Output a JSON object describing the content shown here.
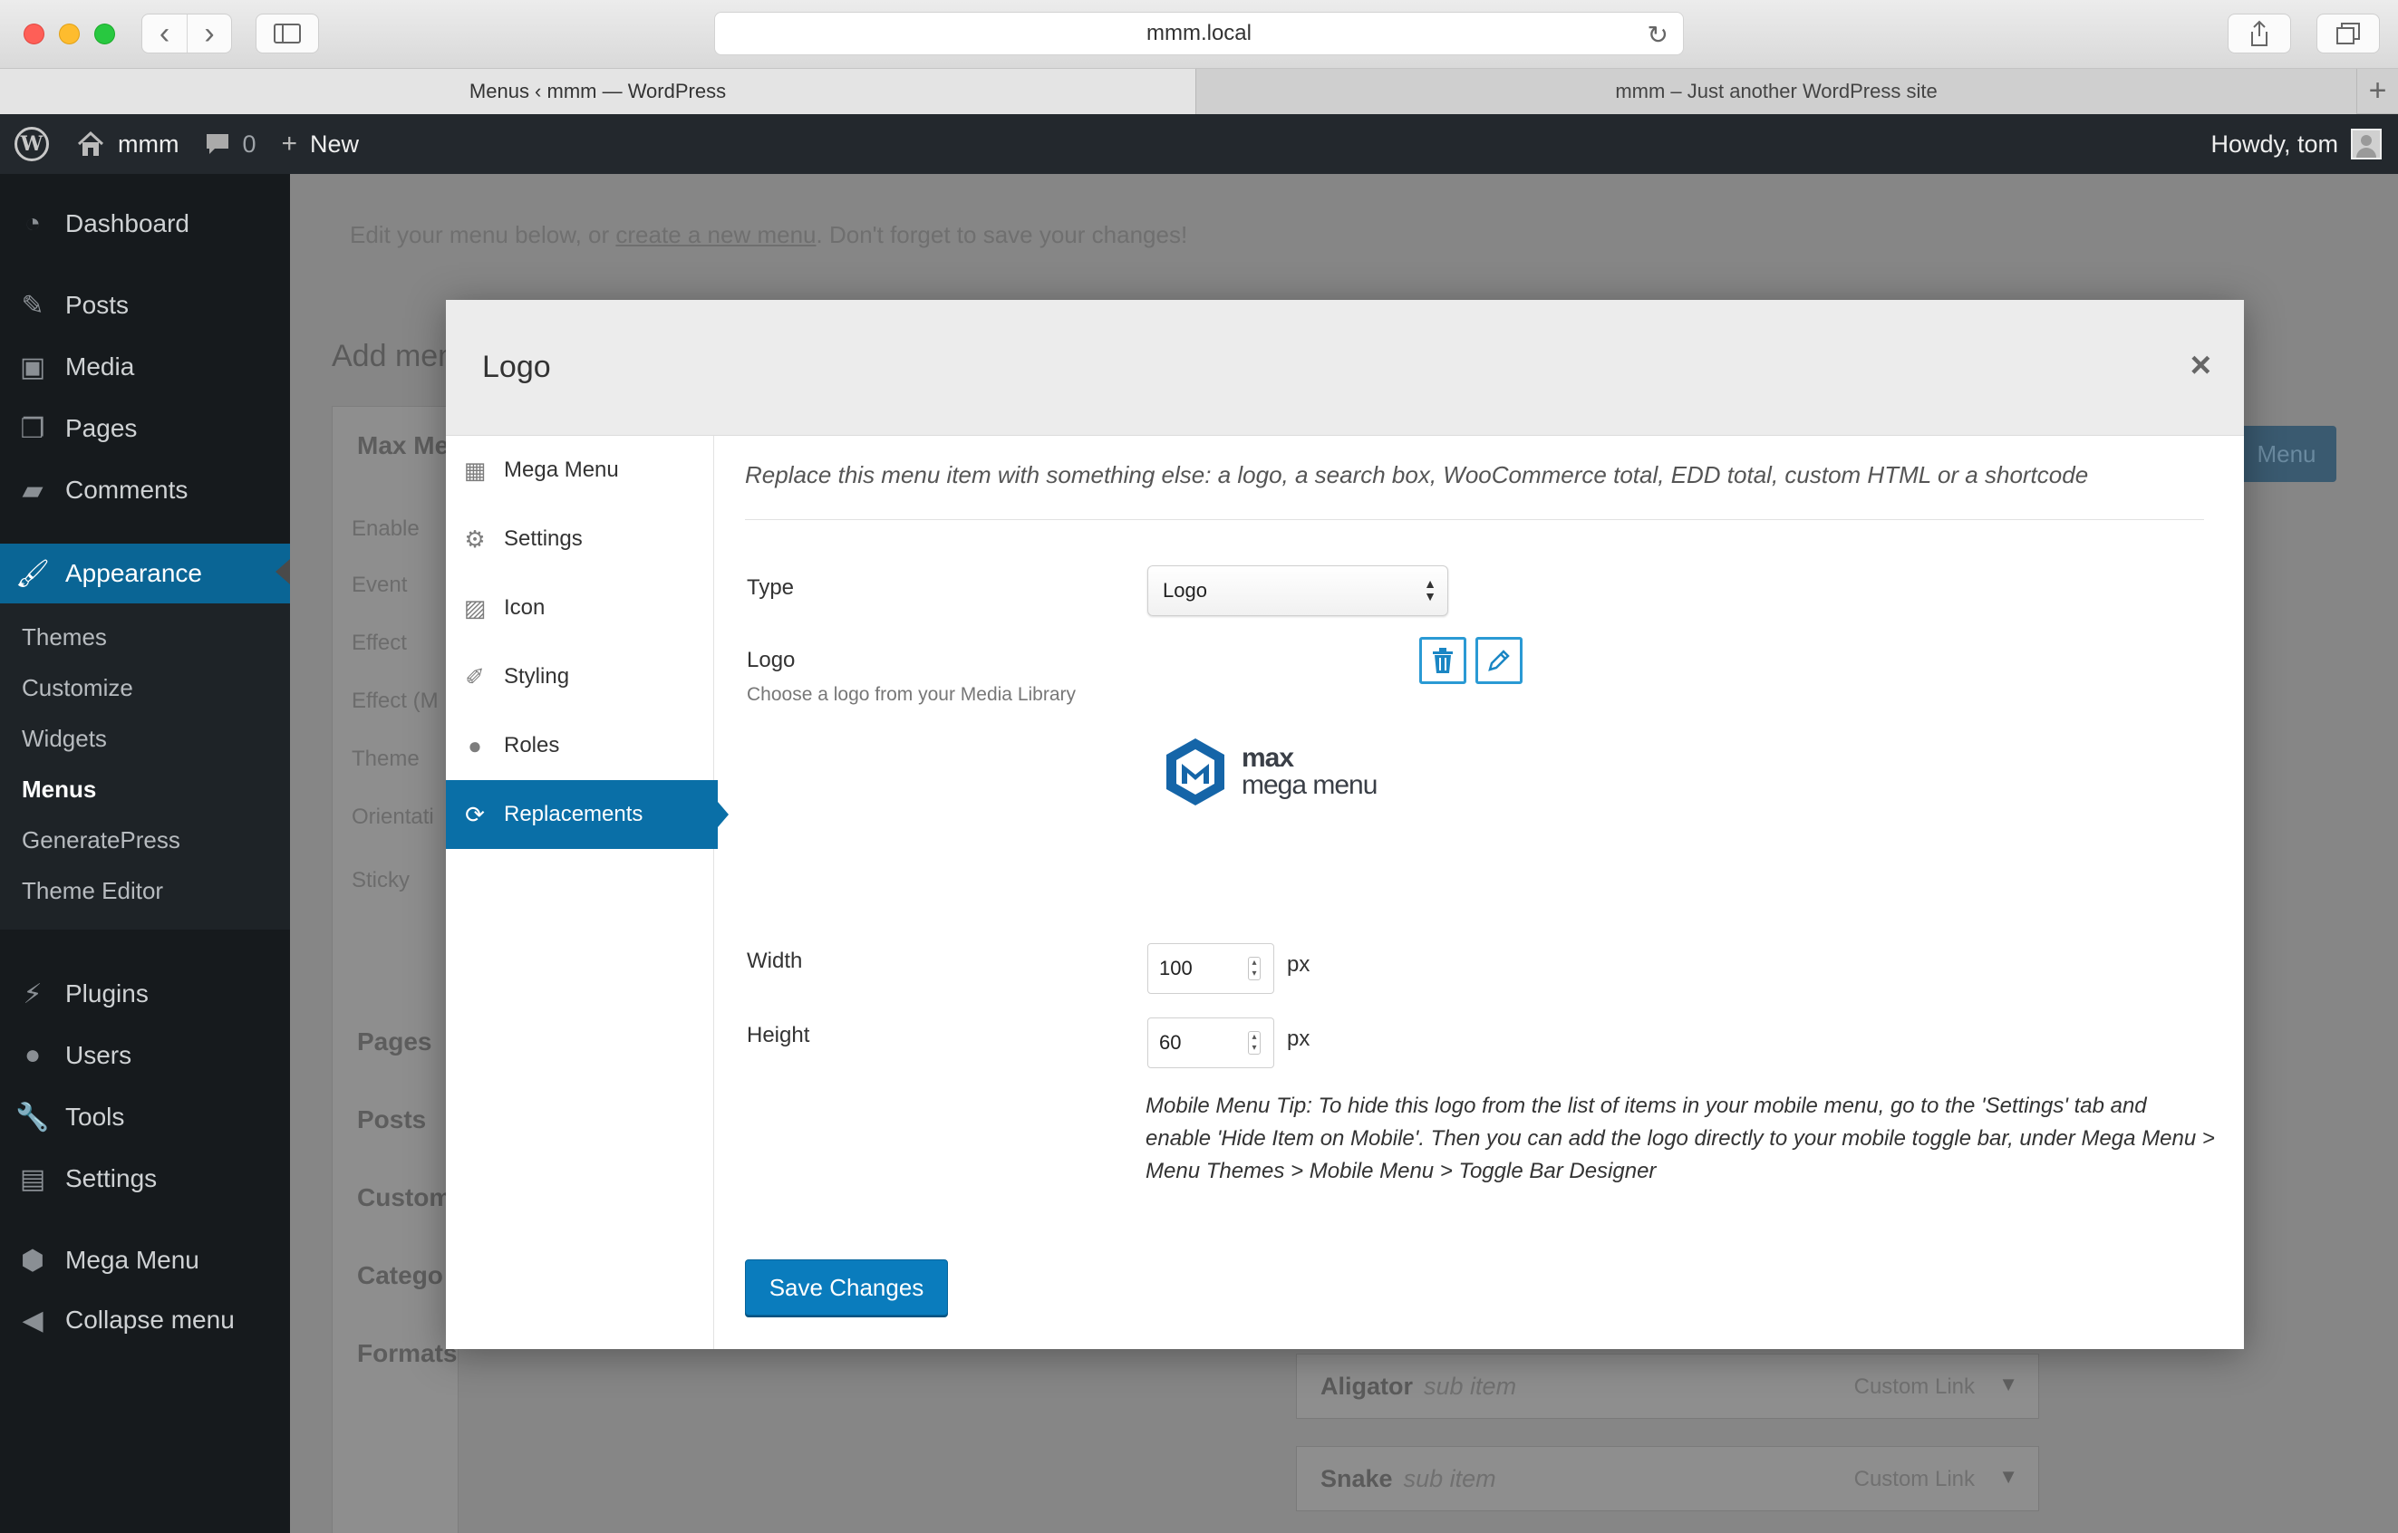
{
  "browser": {
    "url": "mmm.local",
    "tabs": [
      "Menus ‹ mmm — WordPress",
      "mmm – Just another WordPress site"
    ],
    "new_tab_symbol": "+"
  },
  "adminbar": {
    "site_name": "mmm",
    "comments_count": "0",
    "new_label": "New",
    "greeting": "Howdy, tom"
  },
  "sidebar": {
    "items": [
      {
        "label": "Dashboard",
        "icon": "dashboard-icon"
      },
      {
        "label": "Posts",
        "icon": "pin-icon"
      },
      {
        "label": "Media",
        "icon": "media-icon"
      },
      {
        "label": "Pages",
        "icon": "pages-icon"
      },
      {
        "label": "Comments",
        "icon": "comment-icon"
      },
      {
        "label": "Appearance",
        "icon": "paintbrush-icon"
      },
      {
        "label": "Plugins",
        "icon": "plug-icon"
      },
      {
        "label": "Users",
        "icon": "users-icon"
      },
      {
        "label": "Tools",
        "icon": "wrench-icon"
      },
      {
        "label": "Settings",
        "icon": "settings-icon"
      },
      {
        "label": "Mega Menu",
        "icon": "megamenu-icon"
      },
      {
        "label": "Collapse menu",
        "icon": "collapse-icon"
      }
    ],
    "submenu": [
      "Themes",
      "Customize",
      "Widgets",
      "Menus",
      "GeneratePress",
      "Theme Editor"
    ]
  },
  "background": {
    "intro_before": "Edit your menu below, or ",
    "intro_link": "create a new menu",
    "intro_after": ". Don't forget to save your changes!",
    "heading": "Add men",
    "panel_title": "Max Me",
    "panel_labels": [
      "Enable",
      "Event",
      "Effect",
      "Effect (M",
      "Theme",
      "Orientati",
      "Sticky"
    ],
    "sections": [
      "Pages",
      "Posts",
      "Custom",
      "Catego",
      "Formats"
    ],
    "button_fragment": "Menu",
    "menu_rows": [
      {
        "title": "Aligator",
        "sub": "sub item",
        "type": "Custom Link"
      },
      {
        "title": "Snake",
        "sub": "sub item",
        "type": "Custom Link"
      }
    ]
  },
  "modal": {
    "title": "Logo",
    "close_symbol": "×",
    "nav": [
      {
        "label": "Mega Menu",
        "icon": "grid-icon"
      },
      {
        "label": "Settings",
        "icon": "gear-icon"
      },
      {
        "label": "Icon",
        "icon": "image-icon"
      },
      {
        "label": "Styling",
        "icon": "brush-icon"
      },
      {
        "label": "Roles",
        "icon": "person-icon"
      },
      {
        "label": "Replacements",
        "icon": "refresh-icon"
      }
    ],
    "intro": "Replace this menu item with something else: a logo, a search box, WooCommerce total, EDD total, custom HTML or a shortcode",
    "type_label": "Type",
    "type_value": "Logo",
    "logo_label": "Logo",
    "logo_desc": "Choose a logo from your Media Library",
    "logo_word1": "max",
    "logo_word2": "mega menu",
    "width_label": "Width",
    "width_value": "100",
    "height_label": "Height",
    "height_value": "60",
    "unit": "px",
    "tip": "Mobile Menu Tip: To hide this logo from the list of items in your mobile menu, go to the 'Settings' tab and enable 'Hide Item on Mobile'. Then you can add the logo directly to your mobile toggle bar, under Mega Menu > Menu Themes > Mobile Menu > Toggle Bar Designer",
    "save_label": "Save Changes"
  },
  "colors": {
    "wp_blue": "#0a6fa7",
    "adminbar": "#23282d",
    "sidebar": "#161a1d",
    "icon_button": "#2a9ad4"
  }
}
